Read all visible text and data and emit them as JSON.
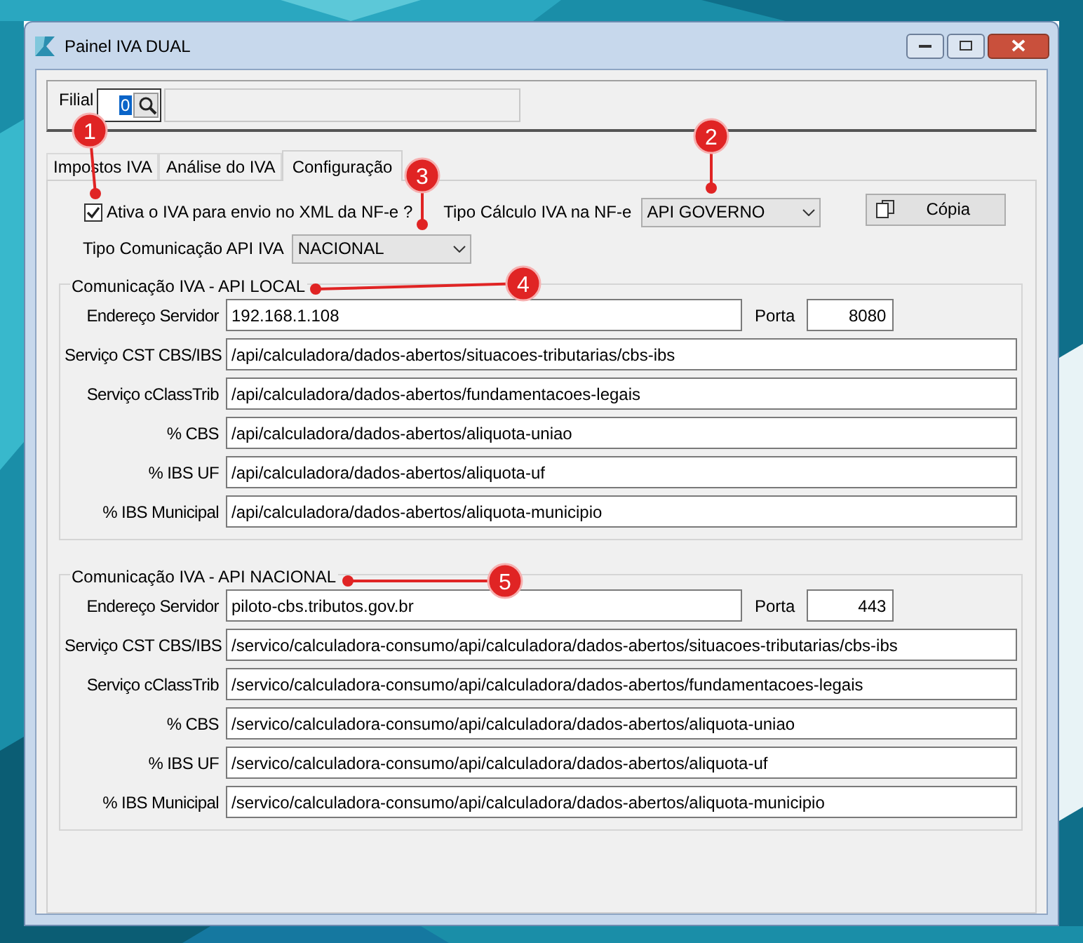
{
  "window": {
    "title": "Painel IVA DUAL"
  },
  "filial": {
    "label": "Filial",
    "value": "0"
  },
  "tabs": [
    {
      "label": "Impostos IVA",
      "selected": false
    },
    {
      "label": "Análise do IVA",
      "selected": false
    },
    {
      "label": "Configuração",
      "selected": true
    }
  ],
  "config": {
    "enable": {
      "label": "Ativa o IVA para envio no XML da NF-e ?",
      "checked": true
    },
    "calc_type": {
      "label": "Tipo Cálculo IVA na NF-e",
      "value": "API GOVERNO"
    },
    "copy_button": "Cópia",
    "comm_type": {
      "label": "Tipo Comunicação API IVA",
      "value": "NACIONAL"
    }
  },
  "groups": [
    {
      "title": "Comunicação IVA - API LOCAL",
      "server": {
        "label": "Endereço Servidor",
        "value": "192.168.1.108"
      },
      "port": {
        "label": "Porta",
        "value": "8080"
      },
      "rows": [
        {
          "label": "Serviço CST CBS/IBS",
          "value": "/api/calculadora/dados-abertos/situacoes-tributarias/cbs-ibs"
        },
        {
          "label": "Serviço cClassTrib",
          "value": "/api/calculadora/dados-abertos/fundamentacoes-legais"
        },
        {
          "label": "% CBS",
          "value": "/api/calculadora/dados-abertos/aliquota-uniao"
        },
        {
          "label": "% IBS UF",
          "value": "/api/calculadora/dados-abertos/aliquota-uf"
        },
        {
          "label": "% IBS Municipal",
          "value": "/api/calculadora/dados-abertos/aliquota-municipio"
        }
      ]
    },
    {
      "title": "Comunicação IVA - API NACIONAL",
      "server": {
        "label": "Endereço Servidor",
        "value": "piloto-cbs.tributos.gov.br"
      },
      "port": {
        "label": "Porta",
        "value": "443"
      },
      "rows": [
        {
          "label": "Serviço CST CBS/IBS",
          "value": "/servico/calculadora-consumo/api/calculadora/dados-abertos/situacoes-tributarias/cbs-ibs"
        },
        {
          "label": "Serviço cClassTrib",
          "value": "/servico/calculadora-consumo/api/calculadora/dados-abertos/fundamentacoes-legais"
        },
        {
          "label": "% CBS",
          "value": "/servico/calculadora-consumo/api/calculadora/dados-abertos/aliquota-uniao"
        },
        {
          "label": "% IBS UF",
          "value": "/servico/calculadora-consumo/api/calculadora/dados-abertos/aliquota-uf"
        },
        {
          "label": "% IBS Municipal",
          "value": "/servico/calculadora-consumo/api/calculadora/dados-abertos/aliquota-municipio"
        }
      ]
    }
  ],
  "callouts": [
    "1",
    "2",
    "3",
    "4",
    "5"
  ]
}
